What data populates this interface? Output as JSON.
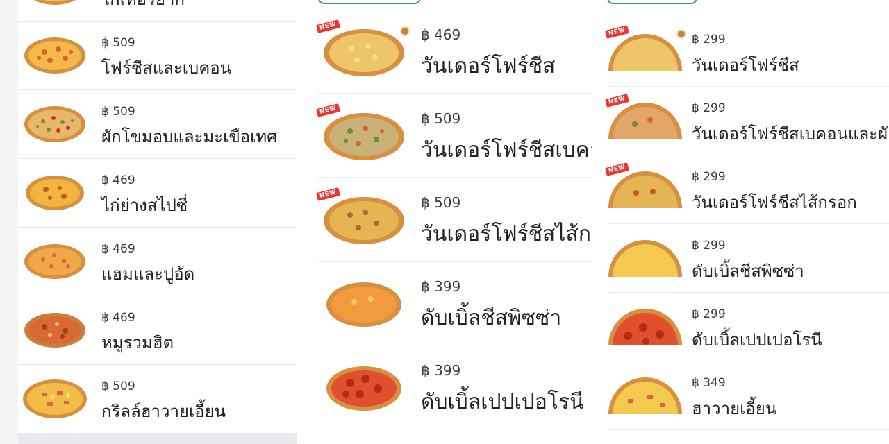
{
  "currency": "฿",
  "column1": {
    "partial_top": {
      "name": "ไก่เทอริยากิ"
    },
    "items": [
      {
        "price": "฿ 509",
        "name": "โฟร์ชีสและเบคอน",
        "icon": "pizza-four-cheese-bacon"
      },
      {
        "price": "฿ 509",
        "name": "ผักโขมอบและมะเขือเทศ",
        "icon": "pizza-spinach-tomato"
      },
      {
        "price": "฿ 469",
        "name": "ไก่ย่างสไปซี่",
        "icon": "pizza-spicy-chicken"
      },
      {
        "price": "฿ 469",
        "name": "แฮมและปูอัด",
        "icon": "pizza-ham-crab"
      },
      {
        "price": "฿ 469",
        "name": "หมูรวมฮิต",
        "icon": "pizza-pork-mix"
      },
      {
        "price": "฿ 509",
        "name": "กริลล์ฮาวายเอี้ยน",
        "icon": "pizza-grilled-hawaiian"
      }
    ]
  },
  "column2": {
    "items": [
      {
        "price": "฿ 469",
        "name": "วันเดอร์โฟร์ชีส",
        "badge": "NEW",
        "icon": "pizza-wonder-four-cheese"
      },
      {
        "price": "฿ 509",
        "name": "วันเดอร์โฟร์ชีสเบคอนและผักโขม",
        "badge": "NEW",
        "icon": "pizza-wonder-bacon-spinach"
      },
      {
        "price": "฿ 509",
        "name": "วันเดอร์โฟร์ชีสไส้กรอก",
        "badge": "NEW",
        "icon": "pizza-wonder-sausage"
      },
      {
        "price": "฿ 399",
        "name": "ดับเบิ้ลชีสพิซซ่า",
        "icon": "pizza-double-cheese"
      },
      {
        "price": "฿ 399",
        "name": "ดับเบิ้ลเปปเปอโรนี",
        "icon": "pizza-double-pepperoni"
      }
    ]
  },
  "column3": {
    "items": [
      {
        "price": "฿ 299",
        "name": "วันเดอร์โฟร์ชีส",
        "badge": "NEW",
        "icon": "pizza-slice-wonder-four-cheese"
      },
      {
        "price": "฿ 299",
        "name": "วันเดอร์โฟร์ชีสเบคอนและผักโขม",
        "badge": "NEW",
        "icon": "pizza-slice-wonder-bacon-spinach"
      },
      {
        "price": "฿ 299",
        "name": "วันเดอร์โฟร์ชีสไส้กรอก",
        "badge": "NEW",
        "icon": "pizza-slice-wonder-sausage"
      },
      {
        "price": "฿ 299",
        "name": "ดับเบิ้ลชีสพิซซ่า",
        "icon": "pizza-slice-double-cheese"
      },
      {
        "price": "฿ 299",
        "name": "ดับเบิ้ลเปปเปอโรนี",
        "icon": "pizza-slice-double-pepperoni"
      },
      {
        "price": "฿ 349",
        "name": "ฮาวายเอี้ยน",
        "icon": "pizza-slice-hawaiian"
      }
    ]
  },
  "colors": {
    "tab_border": "#2f9a6b",
    "new_badge": "#e53935",
    "crust": "#d7903f",
    "cheese": "#f2c14e",
    "sauce": "#e05a2b",
    "pepperoni": "#c8341f",
    "spinach": "#6a8f3a"
  }
}
